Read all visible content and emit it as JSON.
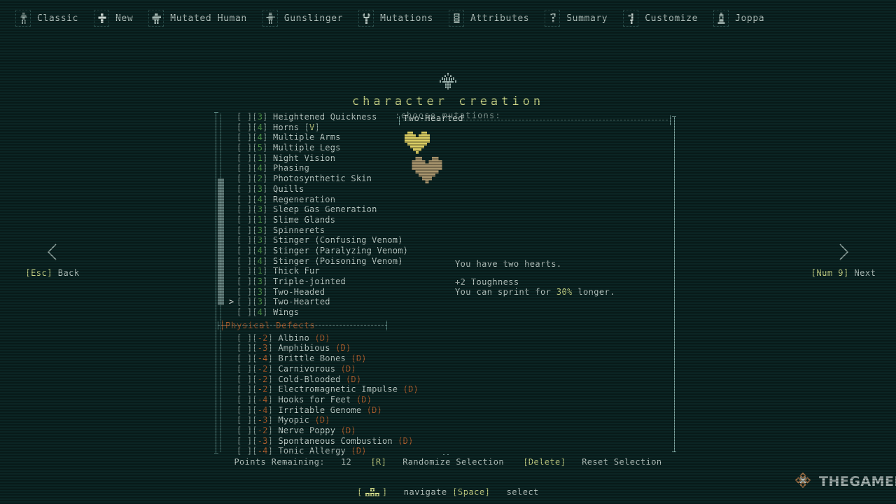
{
  "theme": {
    "background": "#0b2524",
    "text": "#c2d2cd",
    "accent_yellow": "#cdd98a",
    "accent_green": "#4f9a4a",
    "accent_orange": "#b4622f",
    "rail": "#5d8b86"
  },
  "topnav": {
    "items": [
      {
        "label": "Classic",
        "icon": "figure-icon"
      },
      {
        "label": "New",
        "icon": "plus-icon"
      },
      {
        "label": "Mutated Human",
        "icon": "mutated-human-icon"
      },
      {
        "label": "Gunslinger",
        "icon": "gunslinger-icon"
      },
      {
        "label": "Mutations",
        "icon": "mutations-icon"
      },
      {
        "label": "Attributes",
        "icon": "attributes-icon"
      },
      {
        "label": "Summary",
        "icon": "summary-icon"
      },
      {
        "label": "Customize",
        "icon": "customize-icon"
      },
      {
        "label": "Joppa",
        "icon": "joppa-icon"
      }
    ]
  },
  "header": {
    "title": "character creation",
    "subtitle": ":choose mutations:"
  },
  "sidenav": {
    "left": {
      "key": "[Esc]",
      "label": "Back",
      "icon": "chevron-left-icon"
    },
    "right": {
      "key": "[Num 9]",
      "label": "Next",
      "icon": "chevron-right-icon"
    }
  },
  "list": {
    "scroll": {
      "thumb_top_pct": 19.6,
      "thumb_height_pct": 37.4
    },
    "rows": [
      {
        "type": "mutation",
        "selected": false,
        "checkbox": "[ ]",
        "cost": "3",
        "cost_sign": "pos",
        "name": "Heightened Quickness"
      },
      {
        "type": "mutation",
        "selected": false,
        "checkbox": "[ ]",
        "cost": "4",
        "cost_sign": "pos",
        "name": "Horns",
        "variant": "[V]"
      },
      {
        "type": "mutation",
        "selected": false,
        "checkbox": "[ ]",
        "cost": "4",
        "cost_sign": "pos",
        "name": "Multiple Arms"
      },
      {
        "type": "mutation",
        "selected": false,
        "checkbox": "[ ]",
        "cost": "5",
        "cost_sign": "pos",
        "name": "Multiple Legs"
      },
      {
        "type": "mutation",
        "selected": false,
        "checkbox": "[ ]",
        "cost": "1",
        "cost_sign": "pos",
        "name": "Night Vision"
      },
      {
        "type": "mutation",
        "selected": false,
        "checkbox": "[ ]",
        "cost": "4",
        "cost_sign": "pos",
        "name": "Phasing"
      },
      {
        "type": "mutation",
        "selected": false,
        "checkbox": "[ ]",
        "cost": "2",
        "cost_sign": "pos",
        "name": "Photosynthetic Skin"
      },
      {
        "type": "mutation",
        "selected": false,
        "checkbox": "[ ]",
        "cost": "3",
        "cost_sign": "pos",
        "name": "Quills"
      },
      {
        "type": "mutation",
        "selected": false,
        "checkbox": "[ ]",
        "cost": "4",
        "cost_sign": "pos",
        "name": "Regeneration"
      },
      {
        "type": "mutation",
        "selected": false,
        "checkbox": "[ ]",
        "cost": "3",
        "cost_sign": "pos",
        "name": "Sleep Gas Generation"
      },
      {
        "type": "mutation",
        "selected": false,
        "checkbox": "[ ]",
        "cost": "1",
        "cost_sign": "pos",
        "name": "Slime Glands"
      },
      {
        "type": "mutation",
        "selected": false,
        "checkbox": "[ ]",
        "cost": "3",
        "cost_sign": "pos",
        "name": "Spinnerets"
      },
      {
        "type": "mutation",
        "selected": false,
        "checkbox": "[ ]",
        "cost": "3",
        "cost_sign": "pos",
        "name": "Stinger (Confusing Venom)"
      },
      {
        "type": "mutation",
        "selected": false,
        "checkbox": "[ ]",
        "cost": "4",
        "cost_sign": "pos",
        "name": "Stinger (Paralyzing Venom)"
      },
      {
        "type": "mutation",
        "selected": false,
        "checkbox": "[ ]",
        "cost": "4",
        "cost_sign": "pos",
        "name": "Stinger (Poisoning Venom)"
      },
      {
        "type": "mutation",
        "selected": false,
        "checkbox": "[ ]",
        "cost": "1",
        "cost_sign": "pos",
        "name": "Thick Fur"
      },
      {
        "type": "mutation",
        "selected": false,
        "checkbox": "[ ]",
        "cost": "3",
        "cost_sign": "pos",
        "name": "Triple-jointed"
      },
      {
        "type": "mutation",
        "selected": false,
        "checkbox": "[ ]",
        "cost": "3",
        "cost_sign": "pos",
        "name": "Two-Headed"
      },
      {
        "type": "mutation",
        "selected": true,
        "checkbox": "[ ]",
        "cost": "3",
        "cost_sign": "pos",
        "name": "Two-Hearted"
      },
      {
        "type": "mutation",
        "selected": false,
        "checkbox": "[ ]",
        "cost": "4",
        "cost_sign": "pos",
        "name": "Wings"
      },
      {
        "type": "section",
        "label": "Physical Defects"
      },
      {
        "type": "mutation",
        "selected": false,
        "checkbox": "[ ]",
        "cost": "-2",
        "cost_sign": "neg",
        "name": "Albino",
        "tag": "(D)"
      },
      {
        "type": "mutation",
        "selected": false,
        "checkbox": "[ ]",
        "cost": "-3",
        "cost_sign": "neg",
        "name": "Amphibious",
        "tag": "(D)"
      },
      {
        "type": "mutation",
        "selected": false,
        "checkbox": "[ ]",
        "cost": "-4",
        "cost_sign": "neg",
        "name": "Brittle Bones",
        "tag": "(D)"
      },
      {
        "type": "mutation",
        "selected": false,
        "checkbox": "[ ]",
        "cost": "-2",
        "cost_sign": "neg",
        "name": "Carnivorous",
        "tag": "(D)"
      },
      {
        "type": "mutation",
        "selected": false,
        "checkbox": "[ ]",
        "cost": "-2",
        "cost_sign": "neg",
        "name": "Cold-Blooded",
        "tag": "(D)"
      },
      {
        "type": "mutation",
        "selected": false,
        "checkbox": "[ ]",
        "cost": "-2",
        "cost_sign": "neg",
        "name": "Electromagnetic Impulse",
        "tag": "(D)"
      },
      {
        "type": "mutation",
        "selected": false,
        "checkbox": "[ ]",
        "cost": "-4",
        "cost_sign": "neg",
        "name": "Hooks for Feet",
        "tag": "(D)"
      },
      {
        "type": "mutation",
        "selected": false,
        "checkbox": "[ ]",
        "cost": "-4",
        "cost_sign": "neg",
        "name": "Irritable Genome",
        "tag": "(D)"
      },
      {
        "type": "mutation",
        "selected": false,
        "checkbox": "[ ]",
        "cost": "-3",
        "cost_sign": "neg",
        "name": "Myopic",
        "tag": "(D)"
      },
      {
        "type": "mutation",
        "selected": false,
        "checkbox": "[ ]",
        "cost": "-2",
        "cost_sign": "neg",
        "name": "Nerve Poppy",
        "tag": "(D)"
      },
      {
        "type": "mutation",
        "selected": false,
        "checkbox": "[ ]",
        "cost": "-3",
        "cost_sign": "neg",
        "name": "Spontaneous Combustion",
        "tag": "(D)"
      },
      {
        "type": "mutation",
        "selected": false,
        "checkbox": "[ ]",
        "cost": "-4",
        "cost_sign": "neg",
        "name": "Tonic Allergy",
        "tag": "(D)"
      }
    ]
  },
  "detail": {
    "title": "Two-Hearted",
    "description": "You have two hearts.",
    "bonus": "+2 Toughness",
    "extra_prefix": "You can sprint for ",
    "extra_value": "30%",
    "extra_suffix": " longer.",
    "heart_primary_color": "#d8cc63",
    "heart_secondary_color": "#a6946d"
  },
  "statusbar": {
    "points_label": "Points Remaining:",
    "points_value": "12",
    "randomize_key": "[R]",
    "randomize_label": "Randomize Selection",
    "reset_key": "[Delete]",
    "reset_label": "Reset Selection"
  },
  "hintbar": {
    "navigate_icon": "arrow-keys-icon",
    "navigate_label": "navigate",
    "select_key": "[Space]",
    "select_label": "select"
  },
  "watermark": {
    "text": "THEGAMER",
    "icon": "thegamer-logo-icon"
  }
}
